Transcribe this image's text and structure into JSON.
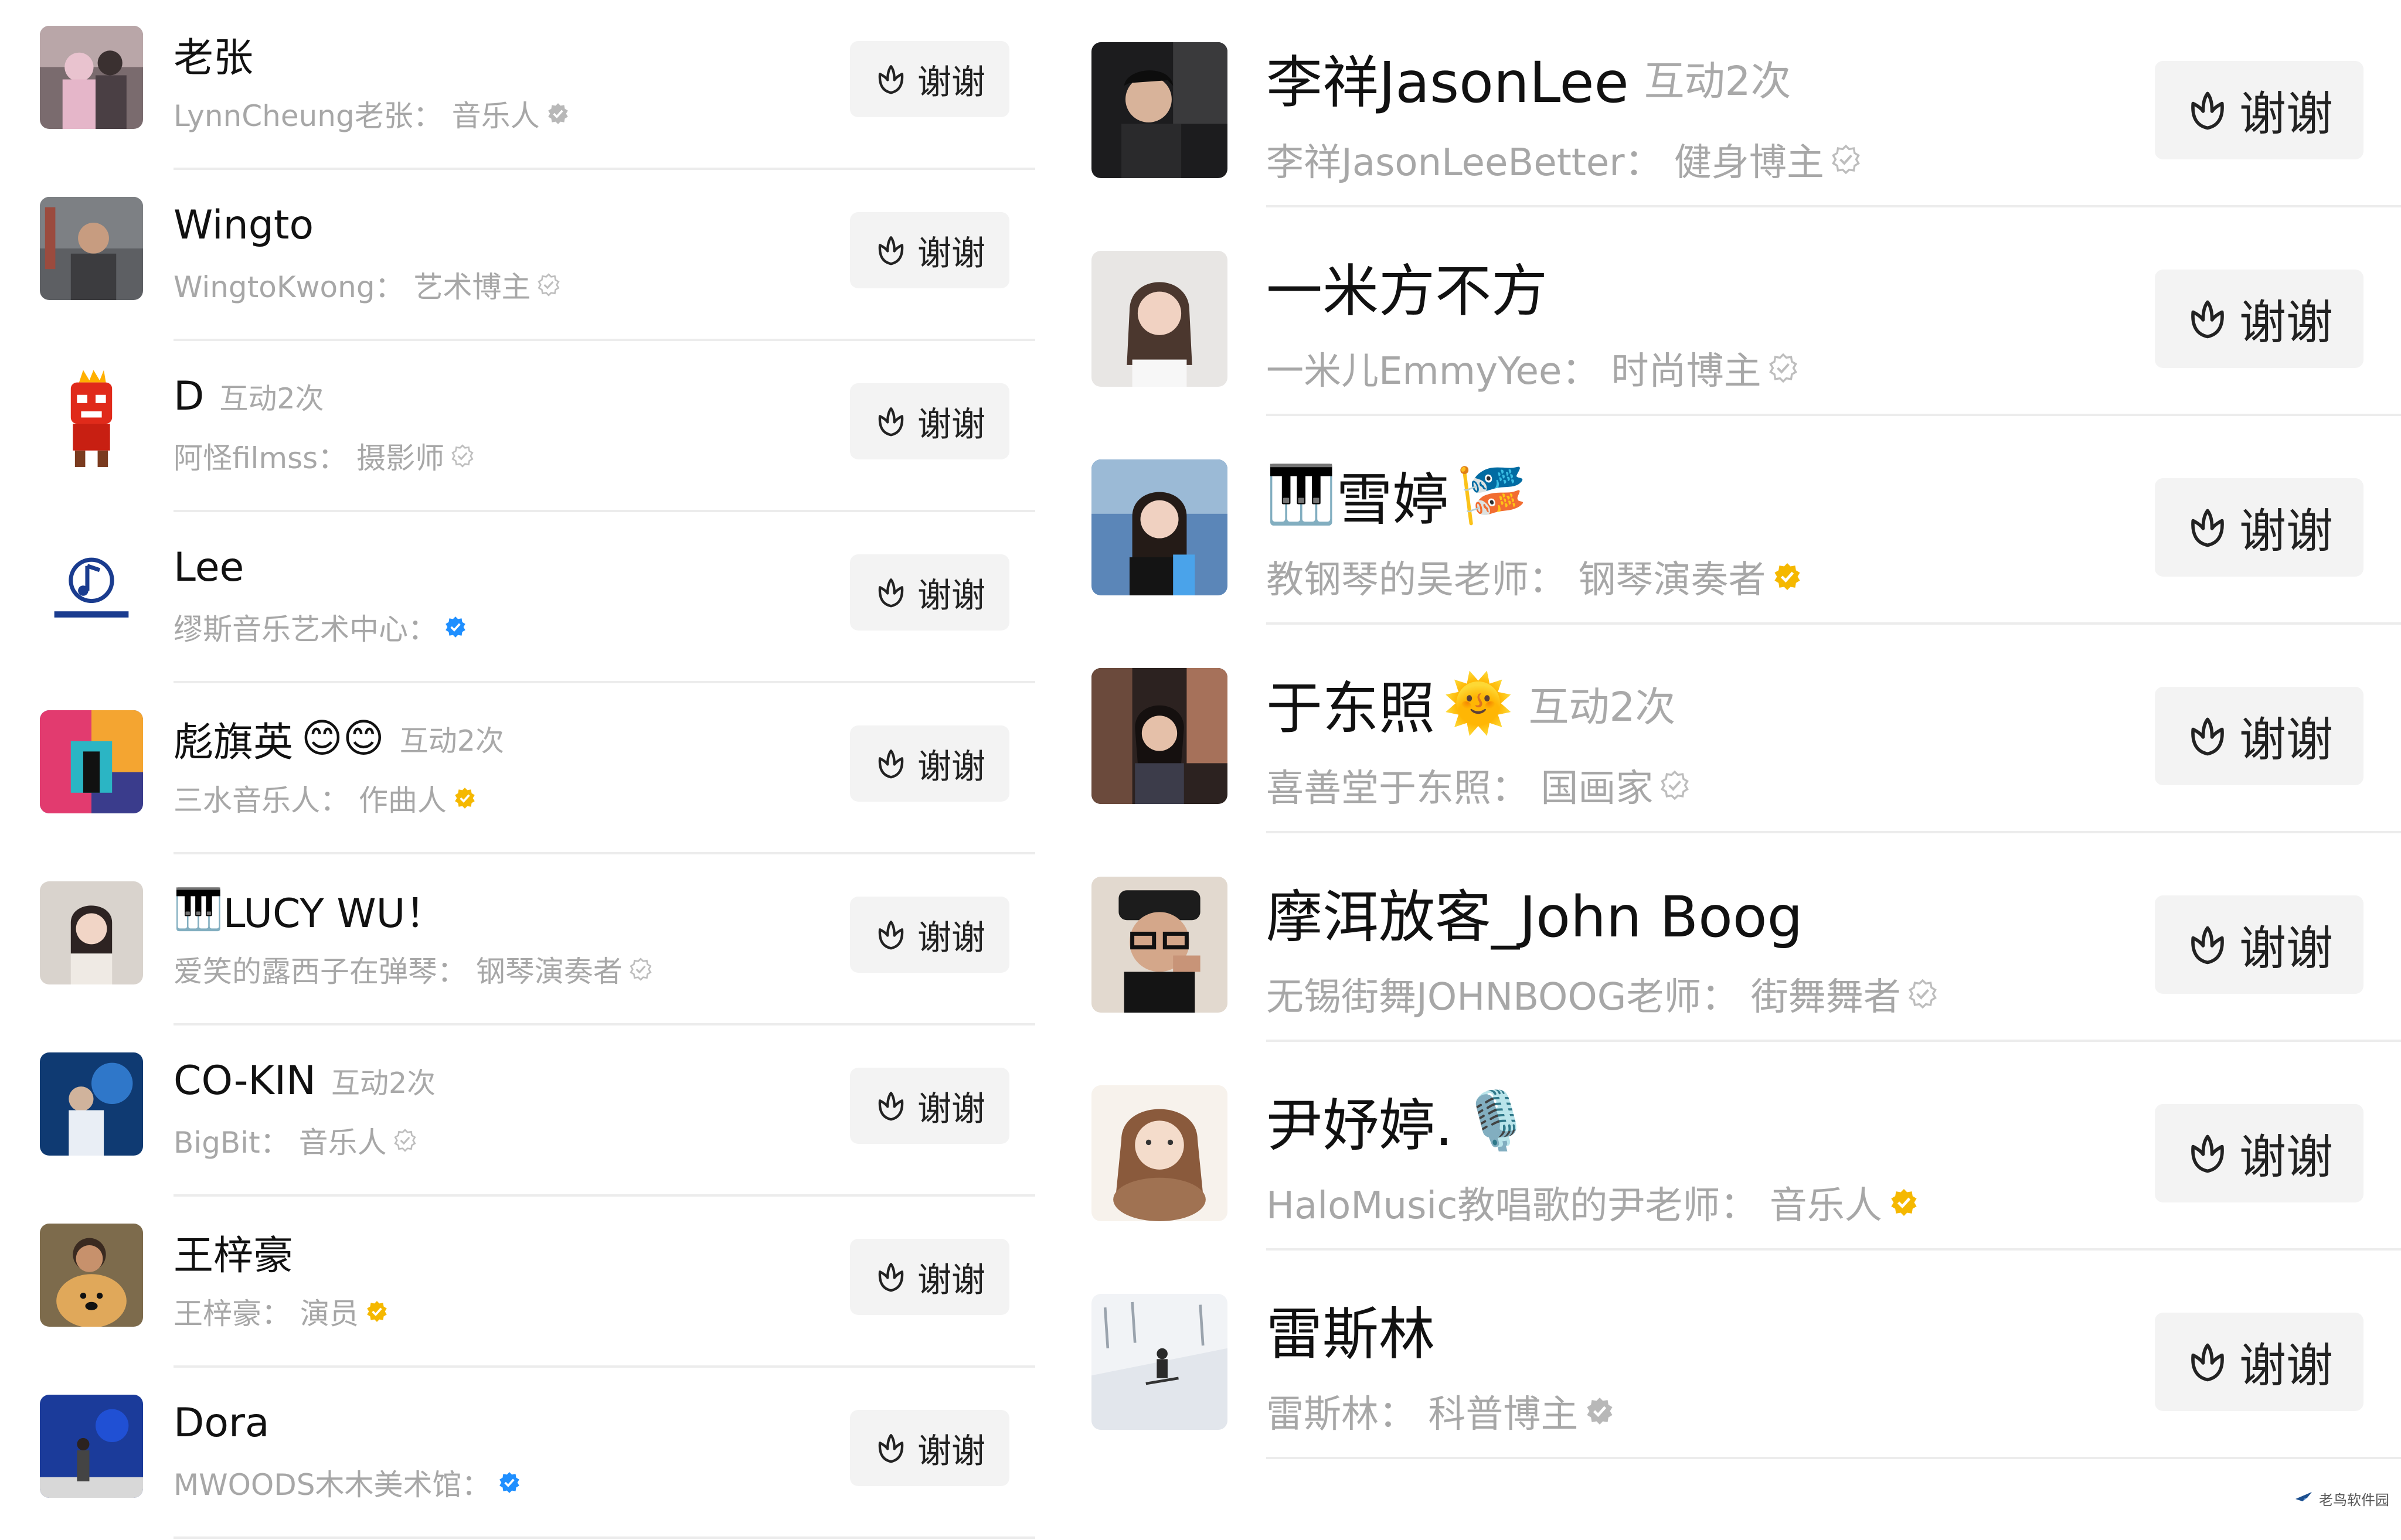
{
  "left_list": [
    {
      "name": "老张",
      "interaction": "",
      "emoji": "",
      "prefix": "",
      "subtitle": "LynnCheung老张：  音乐人",
      "badge": "gray",
      "thanks_label": "谢谢",
      "avatar": "photo-person-pink"
    },
    {
      "name": "Wingto",
      "interaction": "",
      "emoji": "",
      "prefix": "",
      "subtitle": "WingtoKwong：  艺术博主",
      "badge": "outline",
      "thanks_label": "谢谢",
      "avatar": "photo-person-street"
    },
    {
      "name": "D",
      "interaction": "互动2次",
      "emoji": "",
      "prefix": "",
      "subtitle": "阿怪filmss：  摄影师",
      "badge": "outline",
      "thanks_label": "谢谢",
      "avatar": "cartoon-anger"
    },
    {
      "name": "Lee",
      "interaction": "",
      "emoji": "",
      "prefix": "",
      "subtitle": "缪斯音乐艺术中心：",
      "badge": "blue",
      "thanks_label": "谢谢",
      "avatar": "logo-music"
    },
    {
      "name": "彪旗英",
      "interaction": "互动2次",
      "emoji": "😊😊",
      "prefix": "",
      "subtitle": "三水音乐人：  作曲人",
      "badge": "gold",
      "thanks_label": "谢谢",
      "avatar": "photo-colorful-room"
    },
    {
      "name": "LUCY WU！",
      "interaction": "",
      "emoji": "",
      "prefix": "🎹",
      "subtitle": "爱笑的露西子在弹琴：  钢琴演奏者",
      "badge": "outline",
      "thanks_label": "谢谢",
      "avatar": "photo-girl"
    },
    {
      "name": "CO-KIN",
      "interaction": "互动2次",
      "emoji": "",
      "prefix": "",
      "subtitle": "BigBit：  音乐人",
      "badge": "outline",
      "thanks_label": "谢谢",
      "avatar": "photo-stage-blue"
    },
    {
      "name": "王梓豪",
      "interaction": "",
      "emoji": "",
      "prefix": "",
      "subtitle": "王梓豪：  演员",
      "badge": "gold",
      "thanks_label": "谢谢",
      "avatar": "photo-dog"
    },
    {
      "name": "Dora",
      "interaction": "",
      "emoji": "",
      "prefix": "",
      "subtitle": "MWOODS木木美术馆：",
      "badge": "blue",
      "thanks_label": "谢谢",
      "avatar": "photo-blue-art"
    }
  ],
  "right_list": [
    {
      "name": "李祥JasonLee",
      "interaction": "互动2次",
      "emoji": "",
      "prefix": "",
      "subtitle": "李祥JasonLeeBetter：  健身博主",
      "badge": "outline",
      "thanks_label": "谢谢",
      "avatar": "photo-man-car"
    },
    {
      "name": "一米方不方",
      "interaction": "",
      "emoji": "",
      "prefix": "",
      "subtitle": "一米儿EmmyYee：  时尚博主",
      "badge": "outline",
      "thanks_label": "谢谢",
      "avatar": "photo-woman-white"
    },
    {
      "name": "雪婷",
      "interaction": "",
      "emoji": "🎏",
      "prefix": "🎹",
      "subtitle": "教钢琴的吴老师：  钢琴演奏者",
      "badge": "gold",
      "thanks_label": "谢谢",
      "avatar": "photo-woman-blue"
    },
    {
      "name": "于东照",
      "interaction": "互动2次",
      "emoji": "🌞",
      "prefix": "",
      "subtitle": "喜善堂于东照：  国画家",
      "badge": "outline",
      "thanks_label": "谢谢",
      "avatar": "photo-woman-night"
    },
    {
      "name": "摩洱放客_John Boog",
      "interaction": "",
      "emoji": "",
      "prefix": "",
      "subtitle": "无锡街舞JOHNBOOG老师：  街舞舞者",
      "badge": "outline",
      "thanks_label": "谢谢",
      "avatar": "photo-man-glasses"
    },
    {
      "name": "尹妤婷.",
      "interaction": "",
      "emoji": "🎙️",
      "prefix": "",
      "subtitle": "HaloMusic教唱歌的尹老师：  音乐人",
      "badge": "gold",
      "thanks_label": "谢谢",
      "avatar": "drawing-girl"
    },
    {
      "name": "雷斯林",
      "interaction": "",
      "emoji": "",
      "prefix": "",
      "subtitle": "雷斯林：  科普博主",
      "badge": "gray",
      "thanks_label": "谢谢",
      "avatar": "photo-ski-snow"
    }
  ],
  "watermark": "老鸟软件园",
  "colors": {
    "gold_badge": "#F5B800",
    "blue_badge": "#1F8FFF",
    "gray_badge": "#B8B8B8",
    "button_bg": "#F3F3F3"
  }
}
